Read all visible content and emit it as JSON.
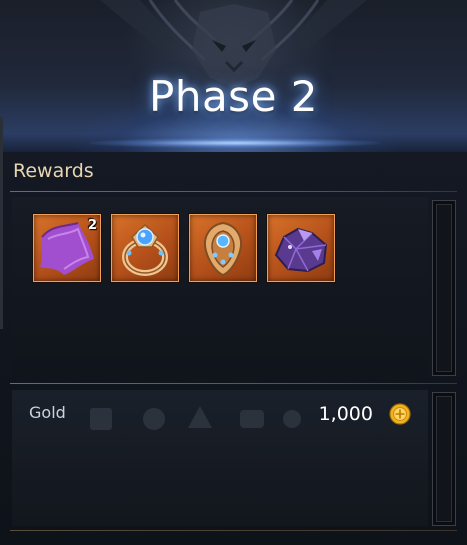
{
  "header": {
    "title": "Phase 2"
  },
  "rewards": {
    "heading": "Rewards",
    "items": [
      {
        "icon": "purple-cloth-icon",
        "quantity": "2"
      },
      {
        "icon": "gem-ring-icon",
        "quantity": ""
      },
      {
        "icon": "gem-earring-icon",
        "quantity": ""
      },
      {
        "icon": "amethyst-crystal-icon",
        "quantity": ""
      }
    ]
  },
  "gold": {
    "label": "Gold",
    "value": "1,000",
    "icon": "gold-coin-icon"
  },
  "colors": {
    "slot_background": "#c45f20",
    "slot_border": "#f0a05a",
    "heading_text": "#e7d5b3",
    "title_glow": "#8cbeff"
  }
}
